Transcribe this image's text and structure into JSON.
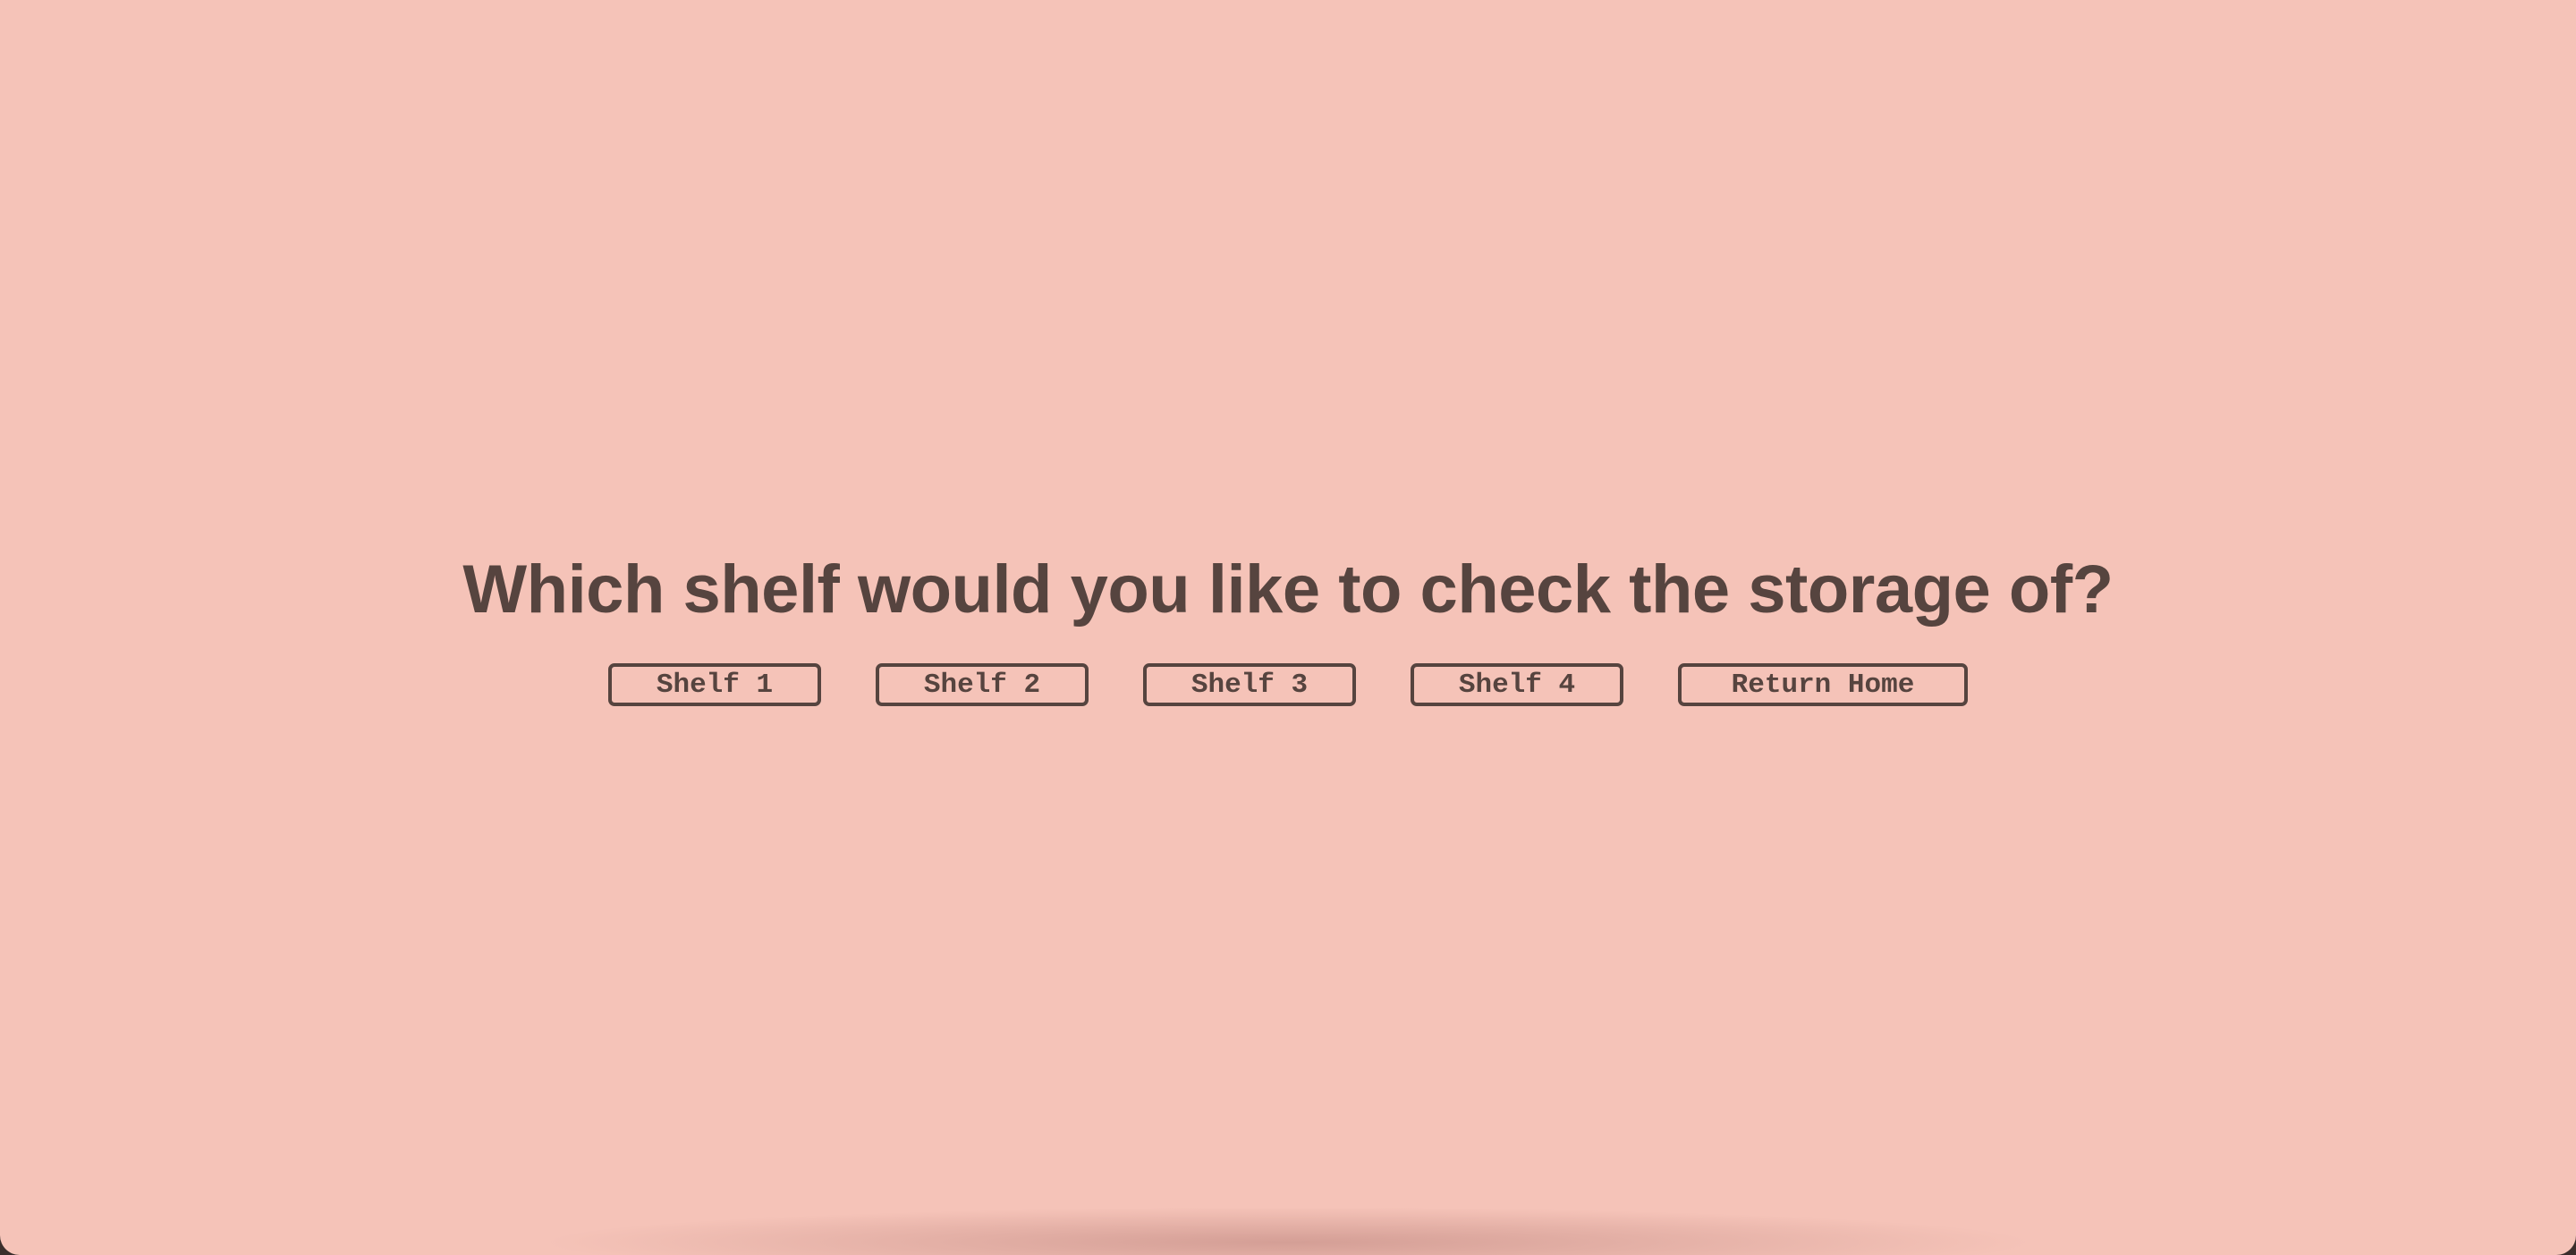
{
  "page": {
    "background_color": "#f5c3b8",
    "text_color": "#56443f"
  },
  "prompt": {
    "question": "Which shelf would you like to check the storage of?"
  },
  "buttons": [
    {
      "label": "Shelf 1"
    },
    {
      "label": "Shelf 2"
    },
    {
      "label": "Shelf 3"
    },
    {
      "label": "Shelf 4"
    },
    {
      "label": "Return Home"
    }
  ]
}
